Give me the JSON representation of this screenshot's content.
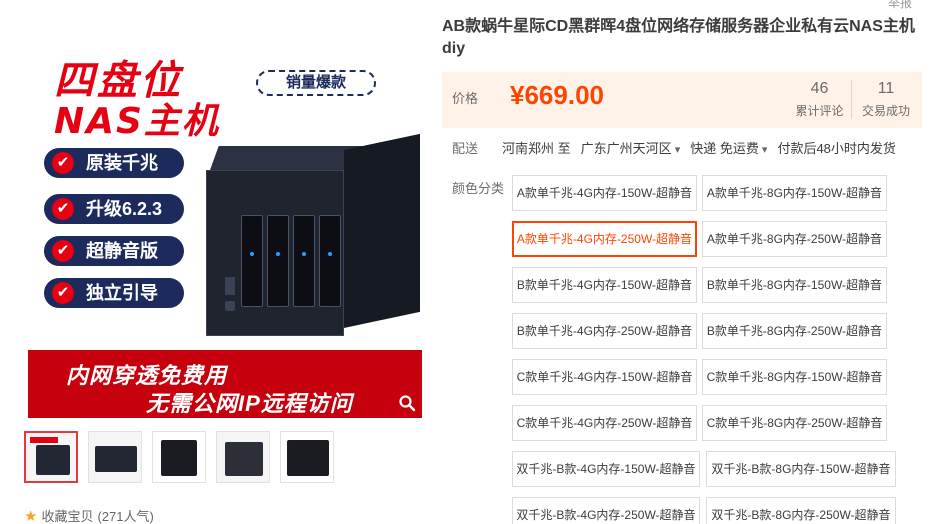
{
  "gallery": {
    "promo_title_1": "四盘位",
    "promo_title_2": "NAS主机",
    "sales_badge": "销量爆款",
    "features": [
      "原装千兆",
      "升级6.2.3",
      "超静音版",
      "独立引导"
    ],
    "banner_line1": "内网穿透免费用",
    "banner_line2": "无需公网IP远程访问",
    "favorite_text": "收藏宝贝",
    "favorite_count": "(271人气)",
    "thumb_count": 5
  },
  "detail": {
    "report": "举报",
    "title": "AB款蜗牛星际CD黑群晖4盘位网络存储服务器企业私有云NAS主机diy",
    "price_label": "价格",
    "price": "¥669.00",
    "reviews_count": "46",
    "reviews_label": "累计评论",
    "sales_count": "11",
    "sales_label": "交易成功",
    "shipping": {
      "label": "配送",
      "from": "河南郑州 至",
      "to": "广东广州天河区",
      "method": "快递 免运费",
      "dispatch": "付款后48小时内发货"
    },
    "options_label": "颜色分类",
    "options": [
      "A款单千兆-4G内存-150W-超静音",
      "A款单千兆-8G内存-150W-超静音",
      "A款单千兆-4G内存-250W-超静音",
      "A款单千兆-8G内存-250W-超静音",
      "B款单千兆-4G内存-150W-超静音",
      "B款单千兆-8G内存-150W-超静音",
      "B款单千兆-4G内存-250W-超静音",
      "B款单千兆-8G内存-250W-超静音",
      "C款单千兆-4G内存-150W-超静音",
      "C款单千兆-8G内存-150W-超静音",
      "C款单千兆-4G内存-250W-超静音",
      "C款单千兆-8G内存-250W-超静音",
      "双千兆-B款-4G内存-150W-超静音",
      "双千兆-B款-8G内存-150W-超静音",
      "双千兆-B款-4G内存-250W-超静音",
      "双千兆-B款-8G内存-250W-超静音"
    ],
    "selected_option": "A款单千兆-4G内存-250W-超静音"
  },
  "colors": {
    "accent": "#ff4400",
    "promo_red": "#e60012",
    "navy": "#1d2a5c",
    "price_bg": "#fff2e8"
  }
}
